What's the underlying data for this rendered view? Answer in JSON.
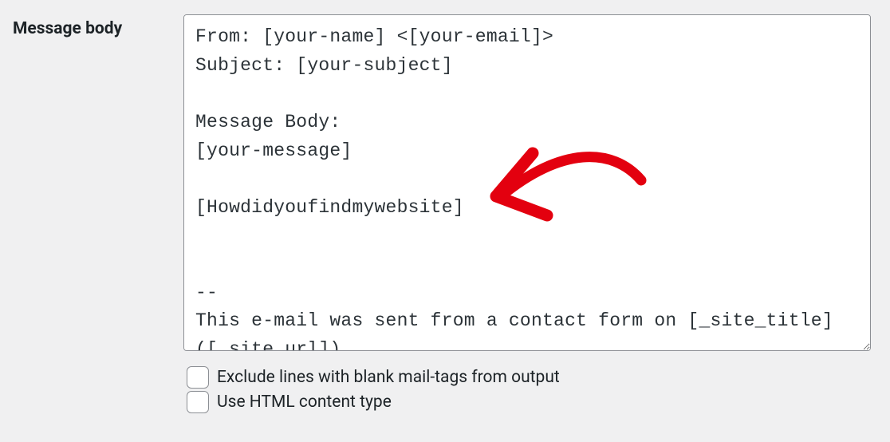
{
  "mail": {
    "body_label": "Message body",
    "body_value": "From: [your-name] <[your-email]>\nSubject: [your-subject]\n\nMessage Body:\n[your-message]\n\n[Howdidyoufindmywebsite]\n\n\n-- \nThis e-mail was sent from a contact form on [_site_title] ([_site_url])",
    "exclude_blank_label": "Exclude lines with blank mail-tags from output",
    "exclude_blank_checked": false,
    "use_html_label": "Use HTML content type",
    "use_html_checked": false
  },
  "annotation": {
    "arrow_color": "#e3000f"
  }
}
